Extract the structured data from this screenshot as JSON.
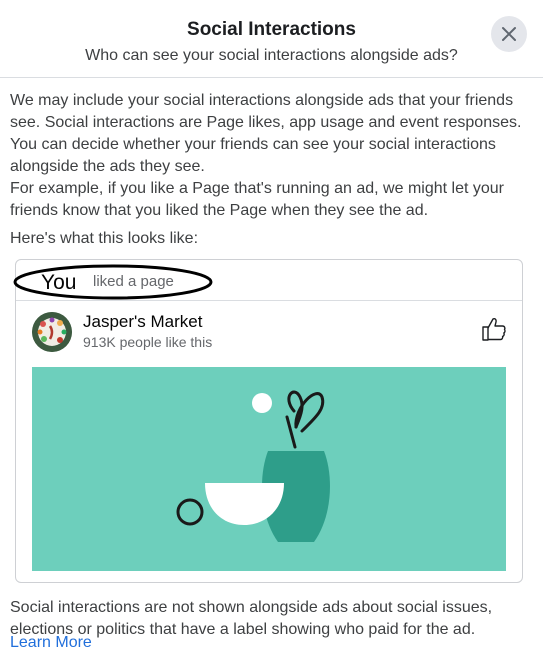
{
  "header": {
    "title": "Social Interactions",
    "subtitle": "Who can see your social interactions alongside ads?"
  },
  "body": {
    "paragraph1": "We may include your social interactions alongside ads that your friends see. Social interactions are Page likes, app usage and event responses. You can decide whether your friends can see your social interactions alongside the ads they see.",
    "paragraph2": "For example, if you like a Page that's running an ad, we might let your friends know that you liked the Page when they see the ad.",
    "paragraph3": "Here's what this looks like:",
    "footer_note": "Social interactions are not shown alongside ads about social issues, elections or politics that have a label showing who paid for the ad.",
    "learn_more": "Learn More"
  },
  "preview": {
    "actor": "You",
    "action": "liked a page",
    "page_name": "Jasper's Market",
    "page_likes": "913K people like this"
  },
  "colors": {
    "ad_background": "#6dcfbc",
    "vase": "#2e9e8a",
    "link": "#216fdb"
  },
  "icons": [
    "close-icon",
    "thumbs-up-icon",
    "page-avatar",
    "ad-illustration"
  ]
}
